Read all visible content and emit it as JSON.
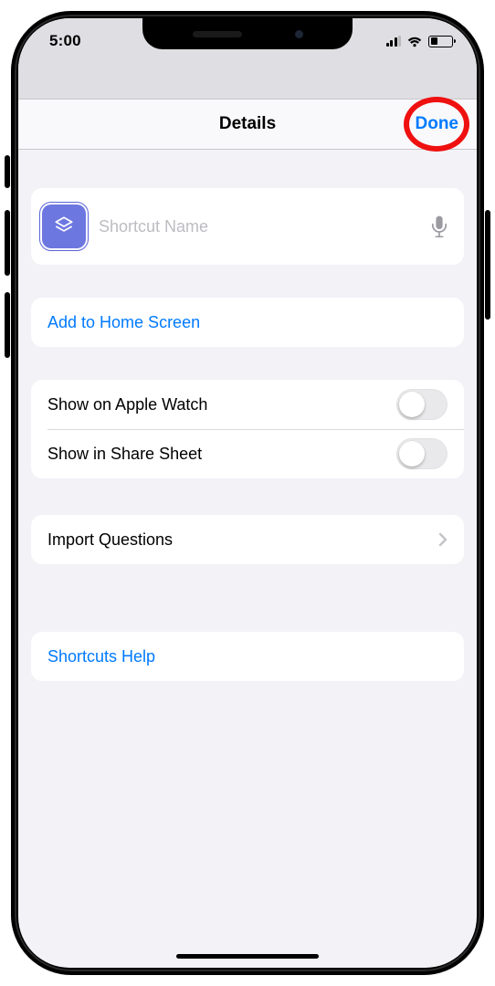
{
  "statusbar": {
    "time": "5:00"
  },
  "nav": {
    "title": "Details",
    "done": "Done"
  },
  "shortcut": {
    "placeholder": "Shortcut Name",
    "value": ""
  },
  "rows": {
    "addHome": "Add to Home Screen",
    "appleWatch": "Show on Apple Watch",
    "shareSheet": "Show in Share Sheet",
    "importQ": "Import Questions",
    "help": "Shortcuts Help"
  },
  "toggles": {
    "appleWatch": false,
    "shareSheet": false
  },
  "colors": {
    "accent": "#007aff",
    "iconBox": "#6d77e0",
    "highlight": "#ef1010"
  }
}
